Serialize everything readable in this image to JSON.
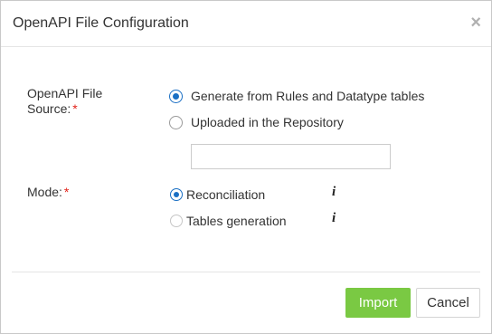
{
  "dialog": {
    "title": "OpenAPI File Configuration",
    "close_symbol": "×",
    "close_icon": "close-icon"
  },
  "form": {
    "source": {
      "label_line1": "OpenAPI File",
      "label_line2": "Source:",
      "required_mark": "*",
      "options": [
        {
          "label": "Generate from Rules and Datatype tables",
          "selected": true
        },
        {
          "label": "Uploaded in the Repository",
          "selected": false
        }
      ],
      "repository_input_value": ""
    },
    "mode": {
      "label": "Mode:",
      "required_mark": "*",
      "options": [
        {
          "label": "Reconciliation",
          "selected": true,
          "info_symbol": "i"
        },
        {
          "label": "Tables generation",
          "selected": false,
          "info_symbol": "i"
        }
      ]
    }
  },
  "footer": {
    "import_label": "Import",
    "cancel_label": "Cancel"
  },
  "colors": {
    "accent": "#1a6fc4",
    "import_button": "#7ac943",
    "required": "#e2231a"
  }
}
